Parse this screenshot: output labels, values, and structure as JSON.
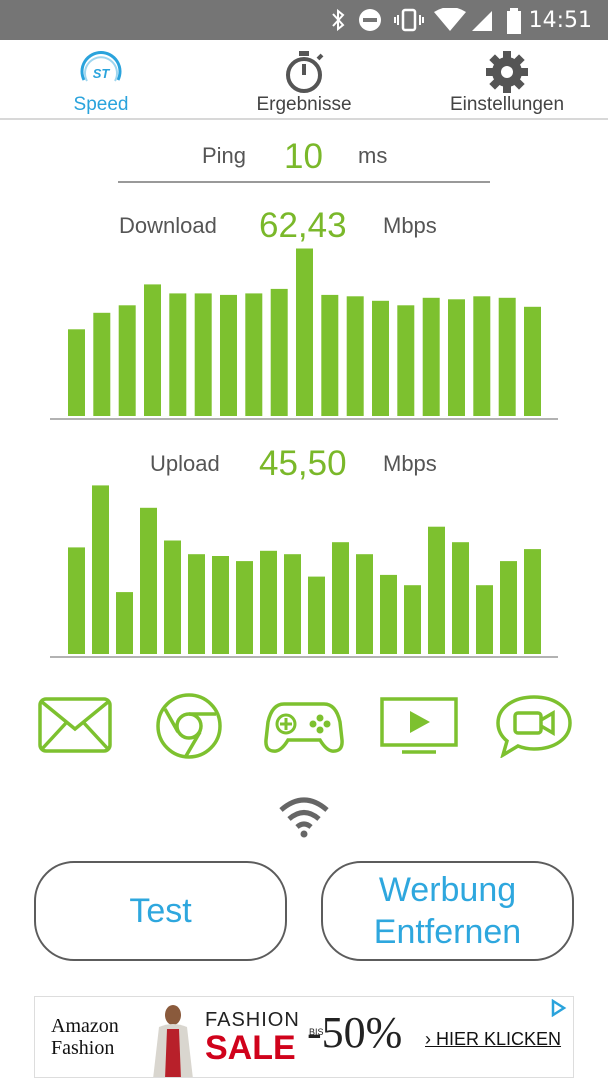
{
  "status_bar": {
    "time": "14:51"
  },
  "tabs": [
    {
      "label": "Speed",
      "icon": "speedtest-logo-icon",
      "logo_text": "ST",
      "active": true
    },
    {
      "label": "Ergebnisse",
      "icon": "stopwatch-icon",
      "active": false
    },
    {
      "label": "Einstellungen",
      "icon": "gear-icon",
      "active": false
    }
  ],
  "ping": {
    "label": "Ping",
    "value": "10",
    "unit": "ms"
  },
  "download": {
    "label": "Download",
    "value": "62,43",
    "unit": "Mbps"
  },
  "upload": {
    "label": "Upload",
    "value": "45,50",
    "unit": "Mbps"
  },
  "chart_data": [
    {
      "type": "bar",
      "name": "download",
      "values": [
        58,
        69,
        74,
        88,
        82,
        82,
        81,
        82,
        85,
        112,
        81,
        80,
        77,
        74,
        79,
        78,
        80,
        79,
        73
      ]
    },
    {
      "type": "bar",
      "name": "upload",
      "values": [
        62,
        98,
        36,
        85,
        66,
        58,
        57,
        54,
        60,
        58,
        45,
        65,
        58,
        46,
        40,
        74,
        65,
        40,
        54,
        61
      ]
    }
  ],
  "app_icons": [
    "envelope-icon",
    "chrome-icon",
    "gamepad-icon",
    "video-screen-icon",
    "video-chat-icon"
  ],
  "wifi_icon": "wifi-icon",
  "buttons": {
    "test": "Test",
    "remove_ads_line1": "Werbung",
    "remove_ads_line2": "Entfernen"
  },
  "ad": {
    "brand_line1": "Amazon",
    "brand_line2": "Fashion",
    "headline1": "FASHION",
    "headline2": "SALE",
    "bis": "BIS",
    "discount": "-50%",
    "cta": "› HIER KLICKEN",
    "colors": {
      "sale": "#d0021b",
      "accent": "#2aa3dc"
    }
  },
  "colors": {
    "bar_green": "#7dc12f",
    "value_green": "#7ab82a",
    "tab_active": "#2aa3dc"
  }
}
